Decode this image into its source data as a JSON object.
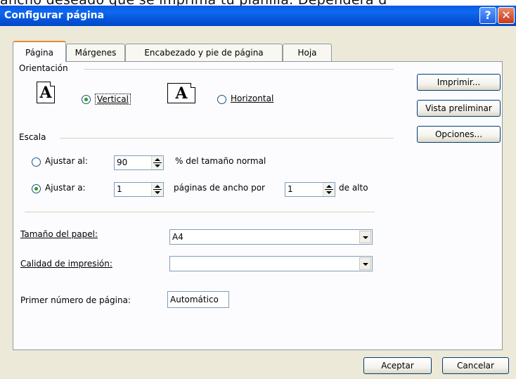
{
  "background_caption": "ancho deseado que se imprima tu planilla. Dependerá d",
  "window": {
    "title": "Configurar página",
    "help_glyph": "?",
    "close_glyph": "✕"
  },
  "tabs": [
    {
      "label": "Página",
      "active": true
    },
    {
      "label": "Márgenes",
      "active": false
    },
    {
      "label": "Encabezado y pie de página",
      "active": false
    },
    {
      "label": "Hoja",
      "active": false
    }
  ],
  "orientation": {
    "group_label": "Orientación",
    "icon_letter": "A",
    "vertical": {
      "label": "Vertical",
      "selected": true
    },
    "horizontal": {
      "label": "Horizontal",
      "selected": false
    }
  },
  "scale": {
    "group_label": "Escala",
    "adjust_to": {
      "label": "Ajustar al:",
      "value": "90",
      "suffix": "% del tamaño normal",
      "selected": false
    },
    "fit_to": {
      "label": "Ajustar a:",
      "pages_wide": "1",
      "middle": "páginas de ancho por",
      "pages_tall": "1",
      "suffix": "de alto",
      "selected": true
    }
  },
  "paper_size": {
    "label": "Tamaño del papel:",
    "value": "A4"
  },
  "print_quality": {
    "label": "Calidad de impresión:",
    "value": ""
  },
  "first_page_number": {
    "label": "Primer número de página:",
    "value": "Automático"
  },
  "side_buttons": {
    "print": "Imprimir...",
    "preview": "Vista preliminar",
    "options": "Opciones..."
  },
  "footer_buttons": {
    "ok": "Aceptar",
    "cancel": "Cancelar"
  },
  "colors": {
    "titlebar": "#0a58e3",
    "dialog": "#ece9d8",
    "panel": "#fcfcfe",
    "border": "#7f9db9",
    "radio_dot": "#21a121"
  }
}
